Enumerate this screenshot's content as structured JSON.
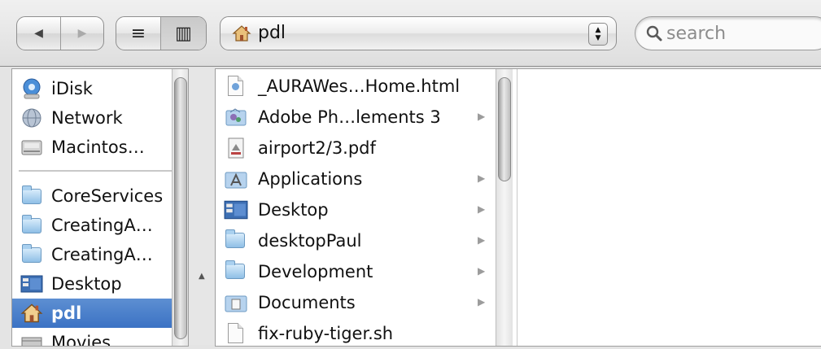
{
  "toolbar": {
    "back_glyph": "◀",
    "forward_glyph": "▶",
    "list_view_glyph": "≡",
    "column_view_glyph": "▥",
    "path": {
      "label": "pdl",
      "icon": "home-icon"
    },
    "stepper_up": "▲",
    "stepper_down": "▼",
    "search": {
      "placeholder": "search",
      "icon": "magnifier-icon"
    }
  },
  "sidebar": {
    "devices": [
      {
        "label": "iDisk",
        "icon": "idisk-icon"
      },
      {
        "label": "Network",
        "icon": "network-icon"
      },
      {
        "label": "Macintos…",
        "icon": "hard-drive-icon"
      }
    ],
    "places": [
      {
        "label": "CoreServices",
        "icon": "folder-icon"
      },
      {
        "label": "CreatingA…",
        "icon": "folder-icon"
      },
      {
        "label": "CreatingA…",
        "icon": "folder-icon"
      },
      {
        "label": "Desktop",
        "icon": "desktop-icon"
      },
      {
        "label": "pdl",
        "icon": "home-icon",
        "selected": true
      },
      {
        "label": "Movies",
        "icon": "movies-icon"
      }
    ]
  },
  "column1": {
    "items": [
      {
        "name": "_AURAWes…Home.html",
        "icon": "html-file-icon",
        "has_children": false
      },
      {
        "name": "Adobe Ph…lements 3",
        "icon": "adobe-folder-icon",
        "has_children": true
      },
      {
        "name": "airport2/3.pdf",
        "icon": "pdf-file-icon",
        "has_children": false
      },
      {
        "name": "Applications",
        "icon": "applications-folder-icon",
        "has_children": true
      },
      {
        "name": "Desktop",
        "icon": "desktop-icon",
        "has_children": true
      },
      {
        "name": "desktopPaul",
        "icon": "folder-icon",
        "has_children": true
      },
      {
        "name": "Development",
        "icon": "folder-icon",
        "has_children": true
      },
      {
        "name": "Documents",
        "icon": "documents-folder-icon",
        "has_children": true
      },
      {
        "name": "fix-ruby-tiger.sh",
        "icon": "document-icon",
        "has_children": false
      }
    ],
    "disclosure_glyph": "▶"
  },
  "scroll_up_glyph": "▲",
  "colors": {
    "selection": "#3b72c4",
    "window_bg": "#e4e4e4",
    "folder": "#8fbfe6"
  }
}
